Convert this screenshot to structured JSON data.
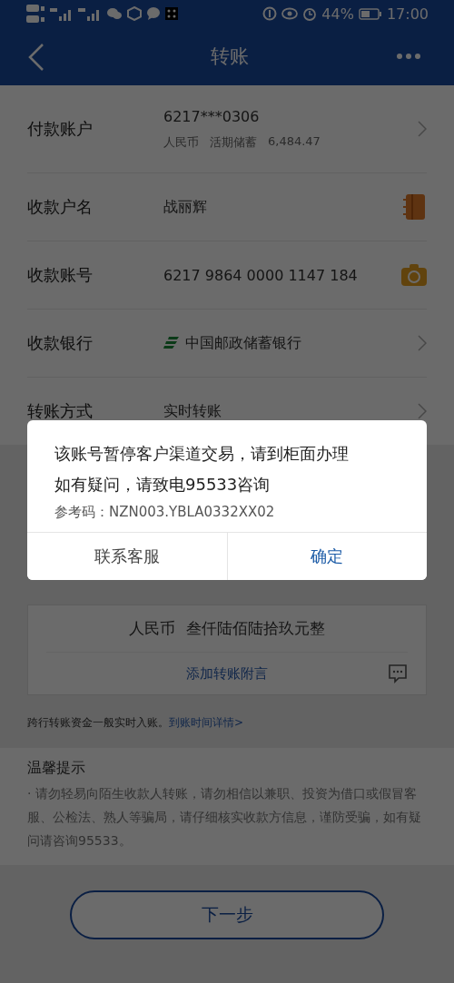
{
  "status_bar": {
    "battery": "44%",
    "time": "17:00"
  },
  "nav": {
    "title": "转账"
  },
  "form_rows": [
    {
      "kind": "account",
      "label": "付款账户",
      "value": "6217***0306",
      "sub": [
        "人民币",
        "活期储蓄",
        "6,484.47"
      ]
    },
    {
      "kind": "contact",
      "label": "收款户名",
      "value": "战丽辉"
    },
    {
      "kind": "camera",
      "label": "收款账号",
      "value": "6217 9864 0000 1147 184"
    },
    {
      "kind": "bank",
      "label": "收款银行",
      "value": "中国邮政储蓄银行"
    },
    {
      "kind": "link",
      "label": "转账方式",
      "value": "实时转账"
    }
  ],
  "amount_card": {
    "amount_words": [
      "人民币",
      "叁仟陆佰陆拾玖元整"
    ],
    "add_note": "添加转账附言"
  },
  "arrival_note": {
    "text": "跨行转账资金一般实时入账。",
    "link": "到账时间详情>"
  },
  "tips": {
    "title": "温馨提示",
    "text": "· 请勿轻易向陌生收款人转账，请勿相信以兼职、投资为借口或假冒客服、公检法、熟人等骗局，请仔细核实收款方信息，谨防受骗，如有疑问请咨询95533。"
  },
  "next_button": "下一步",
  "dialog": {
    "message": [
      "该账号暂停客户渠道交易，请到柜面办理",
      "如有疑问，请致电95533咨询"
    ],
    "reference": "参考码：NZN003.YBLA0332XX02",
    "buttons": [
      {
        "kind": "secondary",
        "label": "联系客服"
      },
      {
        "kind": "primary",
        "label": "确定"
      }
    ]
  }
}
